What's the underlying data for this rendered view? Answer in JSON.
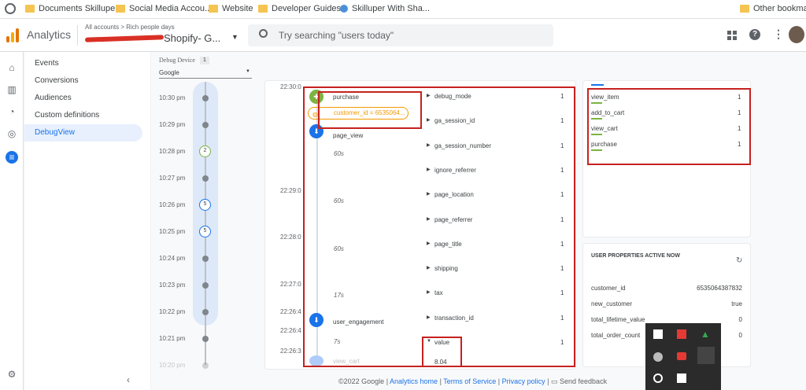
{
  "bookmarks": {
    "items": [
      "Documents Skilluper",
      "Social Media Accou...",
      "Website",
      "Developer Guides",
      "Skilluper With Sha..."
    ],
    "other": "Other bookmarks"
  },
  "header": {
    "product": "Analytics",
    "breadcrumb": "All accounts > Rich people days",
    "property": "Shopify- G...",
    "search_placeholder": "Try searching \"users today\""
  },
  "nav": {
    "items": [
      "Events",
      "Conversions",
      "Audiences",
      "Custom definitions",
      "DebugView"
    ],
    "active": "DebugView"
  },
  "device": {
    "label": "Debug Device",
    "count": "1",
    "selected": "Google"
  },
  "minutes": {
    "times": [
      "10:30 pm",
      "10:29 pm",
      "10:28 pm",
      "10:27 pm",
      "10:26 pm",
      "10:25 pm",
      "10:24 pm",
      "10:23 pm",
      "10:22 pm",
      "10:21 pm",
      "10:20 pm"
    ],
    "badges": {
      "10:28 pm": "2",
      "10:26 pm": "5",
      "10:25 pm": "5"
    }
  },
  "stream": {
    "timestamps": [
      "22:30:0",
      "22:29:0",
      "22:28:0",
      "22:27:0",
      "22:26:4",
      "22:26:4",
      "22:26:3"
    ],
    "events": [
      {
        "name": "purchase"
      },
      {
        "name": "customer_id = 6535064..."
      },
      {
        "name": "page_view"
      },
      {
        "name": "user_engagement"
      },
      {
        "name": "view_cart"
      }
    ],
    "gaps": [
      "60s",
      "60s",
      "60s",
      "17s",
      "7s"
    ]
  },
  "params": {
    "rows": [
      {
        "name": "debug_mode",
        "count": "1"
      },
      {
        "name": "ga_session_id",
        "count": "1"
      },
      {
        "name": "ga_session_number",
        "count": "1"
      },
      {
        "name": "ignore_referrer",
        "count": "1"
      },
      {
        "name": "page_location",
        "count": "1"
      },
      {
        "name": "page_referrer",
        "count": "1"
      },
      {
        "name": "page_title",
        "count": "1"
      },
      {
        "name": "shipping",
        "count": "1"
      },
      {
        "name": "tax",
        "count": "1"
      },
      {
        "name": "transaction_id",
        "count": "1"
      },
      {
        "name": "value",
        "count": "1"
      }
    ],
    "value_expanded": "8.04"
  },
  "top_events": {
    "rows": [
      {
        "name": "view_item",
        "count": "1"
      },
      {
        "name": "add_to_cart",
        "count": "1"
      },
      {
        "name": "view_cart",
        "count": "1"
      },
      {
        "name": "purchase",
        "count": "1"
      }
    ]
  },
  "user_props": {
    "title": "USER PROPERTIES ACTIVE NOW",
    "rows": [
      {
        "name": "customer_id",
        "value": "6535064387832"
      },
      {
        "name": "new_customer",
        "value": "true"
      },
      {
        "name": "total_lifetime_value",
        "value": "0"
      },
      {
        "name": "total_order_count",
        "value": "0"
      }
    ]
  },
  "footer": {
    "copyright": "©2022 Google",
    "links": [
      "Analytics home",
      "Terms of Service",
      "Privacy policy"
    ],
    "feedback": "Send feedback"
  },
  "colors": {
    "accent": "#1a73e8",
    "highlight": "#c5221f",
    "purchase_badge": "#7cb342",
    "event_blue": "#1a73e8",
    "orange": "#f29900"
  }
}
